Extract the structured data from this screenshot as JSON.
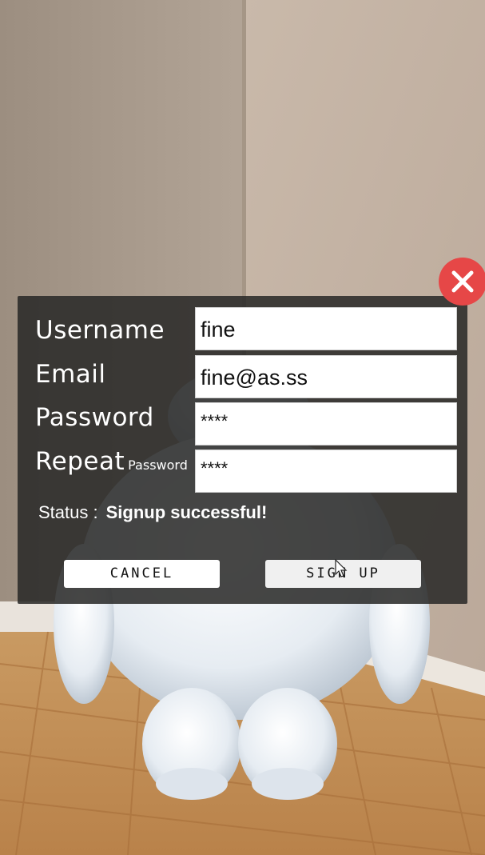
{
  "form": {
    "username_label": "Username",
    "email_label": "Email",
    "password_label": "Password",
    "repeat_label": "Repeat",
    "repeat_sub_label": "Password",
    "username_value": "fine",
    "email_value": "fine@as.ss",
    "password_value": "****",
    "repeat_password_value": "****"
  },
  "status": {
    "label": "Status :",
    "message": "Signup successful!"
  },
  "buttons": {
    "cancel_label": "CANCEL",
    "signup_label": "SIGN UP"
  },
  "icons": {
    "close": "close-icon",
    "cursor": "mouse-pointer-icon"
  },
  "colors": {
    "dialog_bg": "#282826",
    "close_button": "#e64747",
    "wall": "#b8a89a",
    "floor": "#c08a50"
  }
}
